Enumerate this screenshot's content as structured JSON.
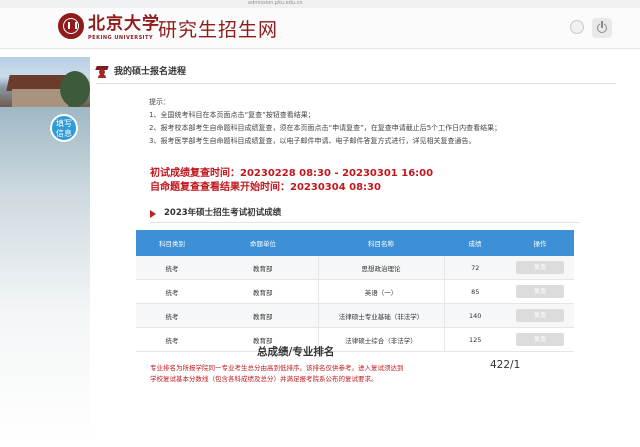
{
  "browser": {
    "url": "admission.pku.edu.cn"
  },
  "header": {
    "logo_cn": "北京大学",
    "logo_en": "PEKING UNIVERSITY",
    "site_title": "研究生招生网",
    "brand_color": "#8f1b1b",
    "icons": [
      "clock-icon",
      "power-icon"
    ]
  },
  "sidebar": {
    "info_line1": "填写",
    "info_line2": "信息",
    "accent_color": "#2f9bd8"
  },
  "section": {
    "title": "我的硕士报名进程"
  },
  "notes": {
    "heading": "提示：",
    "items": [
      "1、全国统考科目在本页面点击“复查”按钮查看结果；",
      "2、报考校本部考生自命题科目成绩复查，须在本页面点击“申请复查”，在复查申请截止后5个工作日内查看结果；",
      "3、报考医学部考生自命题科目成绩复查，以电子邮件申请、电子邮件答复方式进行，详见相关复查通告。"
    ]
  },
  "review_time": {
    "line1": "初试成绩复查时间：20230228 08:30 - 20230301 16:00",
    "line2": "自命题复查查看结果开始时间：20230304 08:30",
    "color": "#c0181e"
  },
  "results": {
    "title": "2023年硕士招生考试初试成绩",
    "columns": [
      "科目类别",
      "命题单位",
      "科目名称",
      "成绩",
      "操作"
    ],
    "rows": [
      {
        "category": "统考",
        "unit": "教育部",
        "subject": "思想政治理论",
        "score": "72",
        "action": "复查"
      },
      {
        "category": "统考",
        "unit": "教育部",
        "subject": "英语（一）",
        "score": "85",
        "action": "复查"
      },
      {
        "category": "统考",
        "unit": "教育部",
        "subject": "法律硕士专业基础（非法学）",
        "score": "140",
        "action": "复查"
      },
      {
        "category": "统考",
        "unit": "教育部",
        "subject": "法律硕士综合（非法学）",
        "score": "125",
        "action": "复查"
      }
    ],
    "header_color": "#3d8fd6"
  },
  "total": {
    "label": "总成绩/专业排名",
    "value": "422/1",
    "note_line1": "专业排名为所报学院同一专业考生总分由高到低排序。该排名仅供参考。进入复试须达到",
    "note_line2": "学校复试基本分数线（包含各科成绩及总分）并满足报考院系公布的复试要求。"
  }
}
